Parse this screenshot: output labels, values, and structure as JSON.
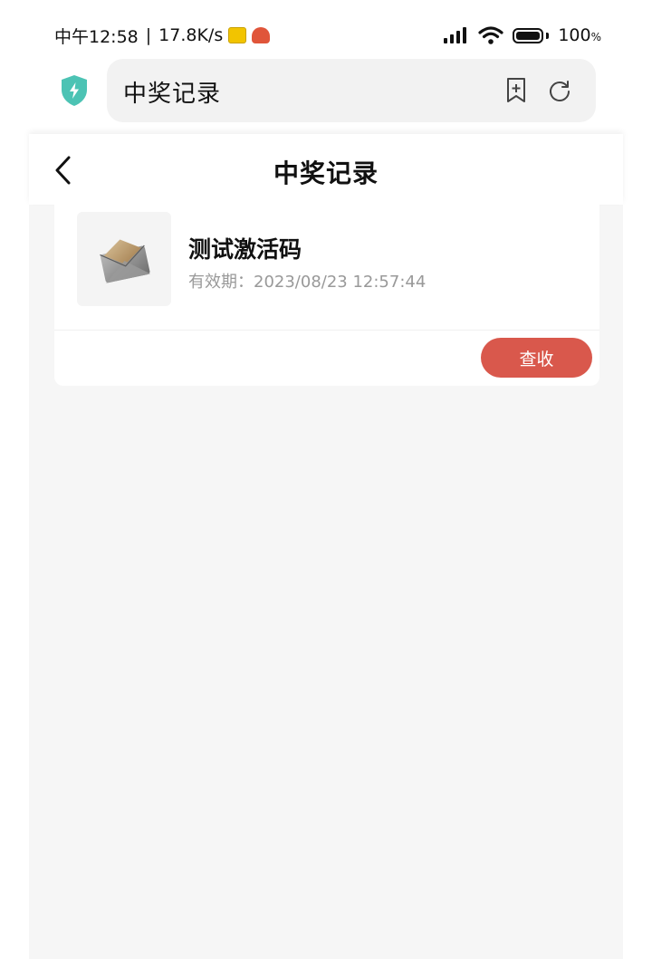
{
  "status_bar": {
    "time": "中午12:58",
    "separator": "|",
    "network_speed": "17.8K/s",
    "battery_level": "100",
    "battery_unit": "%"
  },
  "browser": {
    "url_title": "中奖记录",
    "icons": [
      "shield-bolt-icon",
      "bookmark-add-icon",
      "refresh-icon"
    ]
  },
  "page": {
    "title": "中奖记录",
    "back_icon": "chevron-left-icon"
  },
  "records": [
    {
      "title": "测试激活码",
      "expiry": "有效期：2023/08/23 12:57:44",
      "action_label": "查收",
      "thumbnail": "envelope-icon"
    }
  ],
  "colors": {
    "accent": "#d9584c",
    "shield": "#4cc3b4",
    "background": "#f6f6f6"
  }
}
